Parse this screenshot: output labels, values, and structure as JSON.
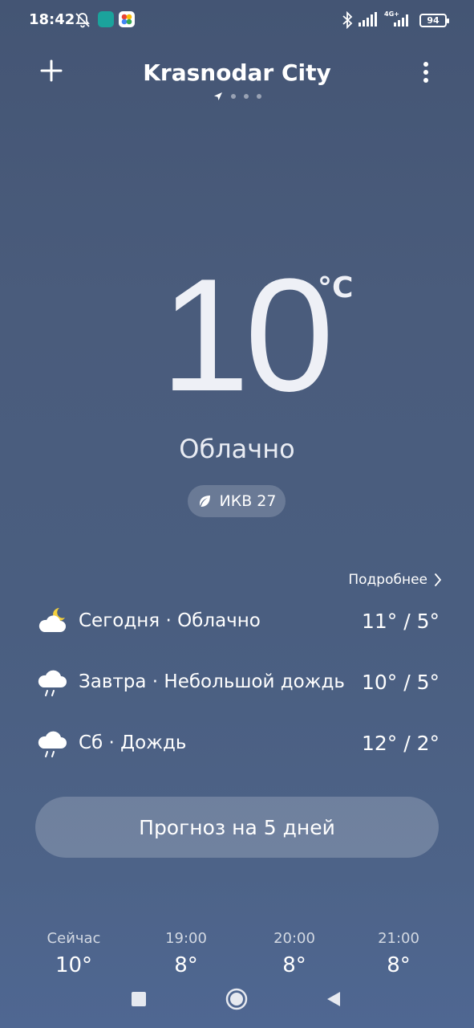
{
  "status_bar": {
    "time": "18:42",
    "battery": "94",
    "network": "4G+",
    "icons": [
      "alarm-off-icon",
      "app-notification-icon",
      "photos-icon",
      "bluetooth-icon",
      "signal-icon"
    ]
  },
  "header": {
    "city": "Krasnodar City",
    "page_count": 4,
    "active_page": 0
  },
  "current": {
    "temperature": "10",
    "unit": "°C",
    "condition": "Облачно",
    "aqi_label": "ИКВ 27"
  },
  "forecast": {
    "more_label": "Подробнее",
    "days": [
      {
        "label": "Сегодня · Облачно",
        "temps": "11° / 5°",
        "icon": "partly-cloudy-icon"
      },
      {
        "label": "Завтра · Небольшой дождь",
        "temps": "10° / 5°",
        "icon": "rain-icon"
      },
      {
        "label": "Сб · Дождь",
        "temps": "12° / 2°",
        "icon": "rain-icon"
      }
    ],
    "five_day_label": "Прогноз на 5 дней"
  },
  "hourly": [
    {
      "time": "Сейчас",
      "temp": "10°"
    },
    {
      "time": "19:00",
      "temp": "8°"
    },
    {
      "time": "20:00",
      "temp": "8°"
    },
    {
      "time": "21:00",
      "temp": "8°"
    }
  ],
  "colors": {
    "background_top": "#445574",
    "background_bottom": "#4f6792",
    "text": "#ffffff"
  }
}
